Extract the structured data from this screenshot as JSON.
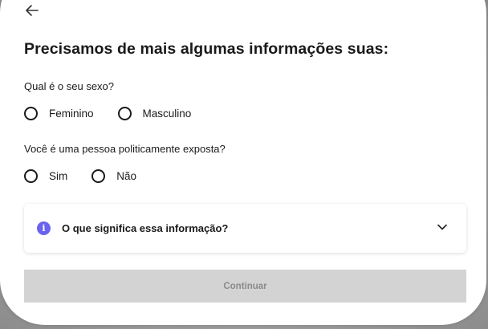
{
  "header": {
    "back_icon": "arrow-left-icon"
  },
  "form": {
    "title": "Precisamos de mais algumas informações suas:",
    "sex_question": "Qual é o seu sexo?",
    "sex_options": [
      "Feminino",
      "Masculino"
    ],
    "pep_question": "Você é uma pessoa politicamente exposta?",
    "pep_options": [
      "Sim",
      "Não"
    ]
  },
  "info": {
    "icon": "info-icon",
    "icon_glyph": "i",
    "label": "O que significa essa informação?",
    "chevron": "chevron-down-icon",
    "accent_color": "#6a63f0"
  },
  "actions": {
    "continue_label": "Continuar",
    "continue_disabled": true
  }
}
